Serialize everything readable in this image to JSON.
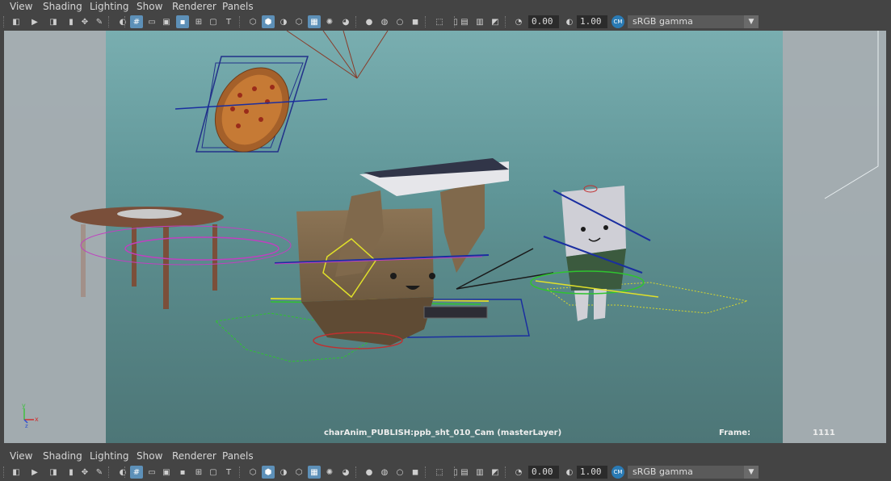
{
  "menus": [
    "View",
    "Shading",
    "Lighting",
    "Show",
    "Renderer",
    "Panels"
  ],
  "toolbar": {
    "exposure": "0.00",
    "gamma": "1.00",
    "colorspace_icon": "color-management-icon",
    "colorspace": "sRGB gamma"
  },
  "hud": {
    "camera": "charAnim_PUBLISH:ppb_sht_010_Cam (masterLayer)",
    "frame_label": "Frame:",
    "frame_value": "1111"
  },
  "axis": {
    "y": "y",
    "x": "x",
    "z": "z"
  },
  "colors": {
    "viewport_bg": "#5b8c8e",
    "film_gate": "#a5adb1",
    "ui_bg": "#444444",
    "active": "#5d90b8"
  }
}
